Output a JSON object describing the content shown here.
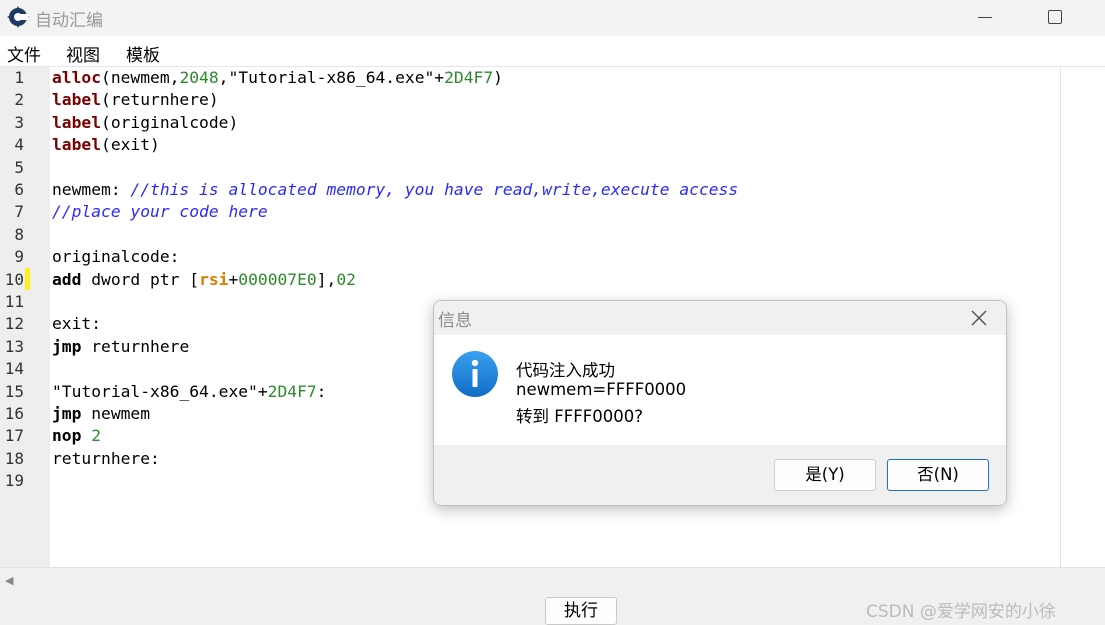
{
  "window": {
    "title": "自动汇编"
  },
  "menu": {
    "items": [
      "文件",
      "视图",
      "模板"
    ]
  },
  "editor": {
    "line_numbers": [
      "1",
      "2",
      "3",
      "4",
      "5",
      "6",
      "7",
      "8",
      "9",
      "10",
      "11",
      "12",
      "13",
      "14",
      "15",
      "16",
      "17",
      "18",
      "19"
    ],
    "highlighted_line": 10,
    "lines": [
      [
        {
          "t": "alloc",
          "c": "kw"
        },
        {
          "t": "(newmem,",
          "c": "plain"
        },
        {
          "t": "2048",
          "c": "num"
        },
        {
          "t": ",\"Tutorial-x86_64.exe\"+",
          "c": "plain"
        },
        {
          "t": "2D4F7",
          "c": "num"
        },
        {
          "t": ")",
          "c": "plain"
        }
      ],
      [
        {
          "t": "label",
          "c": "kw"
        },
        {
          "t": "(returnhere)",
          "c": "plain"
        }
      ],
      [
        {
          "t": "label",
          "c": "kw"
        },
        {
          "t": "(originalcode)",
          "c": "plain"
        }
      ],
      [
        {
          "t": "label",
          "c": "kw"
        },
        {
          "t": "(exit)",
          "c": "plain"
        }
      ],
      [],
      [
        {
          "t": "newmem: ",
          "c": "plain"
        },
        {
          "t": "//this is allocated memory, you have read,write,execute access",
          "c": "cmt"
        }
      ],
      [
        {
          "t": "//place your code here",
          "c": "cmt"
        }
      ],
      [],
      [
        {
          "t": "originalcode:",
          "c": "plain"
        }
      ],
      [
        {
          "t": "add",
          "c": "instr"
        },
        {
          "t": " dword ptr [",
          "c": "plain"
        },
        {
          "t": "rsi",
          "c": "reg"
        },
        {
          "t": "+",
          "c": "plain"
        },
        {
          "t": "000007E0",
          "c": "num"
        },
        {
          "t": "],",
          "c": "plain"
        },
        {
          "t": "02",
          "c": "num"
        }
      ],
      [],
      [
        {
          "t": "exit:",
          "c": "plain"
        }
      ],
      [
        {
          "t": "jmp",
          "c": "instr"
        },
        {
          "t": " returnhere",
          "c": "plain"
        }
      ],
      [],
      [
        {
          "t": "\"Tutorial-x86_64.exe\"+",
          "c": "plain"
        },
        {
          "t": "2D4F7",
          "c": "num"
        },
        {
          "t": ":",
          "c": "plain"
        }
      ],
      [
        {
          "t": "jmp",
          "c": "instr"
        },
        {
          "t": " newmem",
          "c": "plain"
        }
      ],
      [
        {
          "t": "nop",
          "c": "instr"
        },
        {
          "t": " ",
          "c": "plain"
        },
        {
          "t": "2",
          "c": "num"
        }
      ],
      [
        {
          "t": "returnhere:",
          "c": "plain"
        }
      ],
      []
    ]
  },
  "bottom": {
    "execute_label": "执行",
    "watermark": "CSDN @爱学网安的小徐"
  },
  "dialog": {
    "title": "信息",
    "message_lines": [
      "代码注入成功",
      "newmem=FFFF0000",
      "转到 FFFF0000?"
    ],
    "yes_label": "是(Y)",
    "no_label": "否(N)",
    "icon": "info-icon"
  },
  "colors": {
    "keyword": "#7a0000",
    "number": "#2e8b2e",
    "comment": "#2a2aff",
    "register": "#d58000",
    "line_marker": "#ffee22",
    "info_blue": "#1a7fd6"
  }
}
